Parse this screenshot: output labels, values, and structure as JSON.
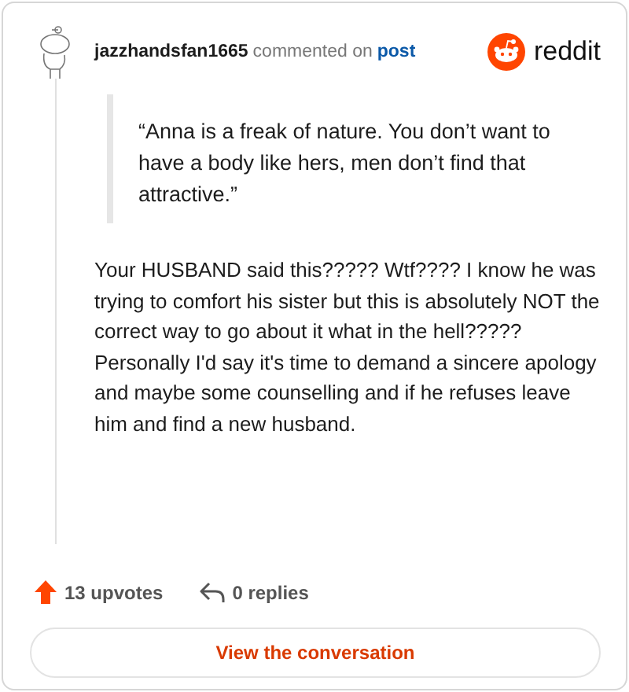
{
  "header": {
    "author": "jazzhandsfan1665",
    "action": "commented on",
    "link": "post",
    "brand": "reddit"
  },
  "quote": "“Anna is a freak of nature. You don’t want to have a body like hers, men don’t find that attractive.”",
  "comment": "Your HUSBAND said this????? Wtf???? I know he was trying to comfort his sister but this is absolutely NOT the correct way to go about it what in the hell????? Personally I'd say it's time to demand a sincere apology and maybe some counselling and if he refuses leave him and find a new husband.",
  "footer": {
    "upvotes": "13 upvotes",
    "replies": "0 replies"
  },
  "button": "View the conversation"
}
